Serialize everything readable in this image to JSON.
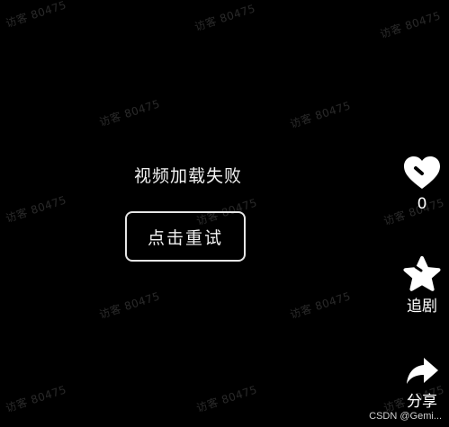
{
  "player": {
    "error_message": "视频加载失败",
    "retry_label": "点击重试"
  },
  "side_actions": {
    "like": {
      "icon": "heart-icon",
      "count": "0"
    },
    "collect": {
      "icon": "star-icon",
      "label": "追剧"
    },
    "share": {
      "icon": "share-arrow-icon",
      "label": "分享"
    }
  },
  "watermark": {
    "text": "访客 80475"
  },
  "credit": {
    "text": "CSDN @Gemi..."
  },
  "colors": {
    "background": "#000000",
    "text": "#ffffff",
    "watermark": "rgba(255,255,255,0.16)"
  }
}
